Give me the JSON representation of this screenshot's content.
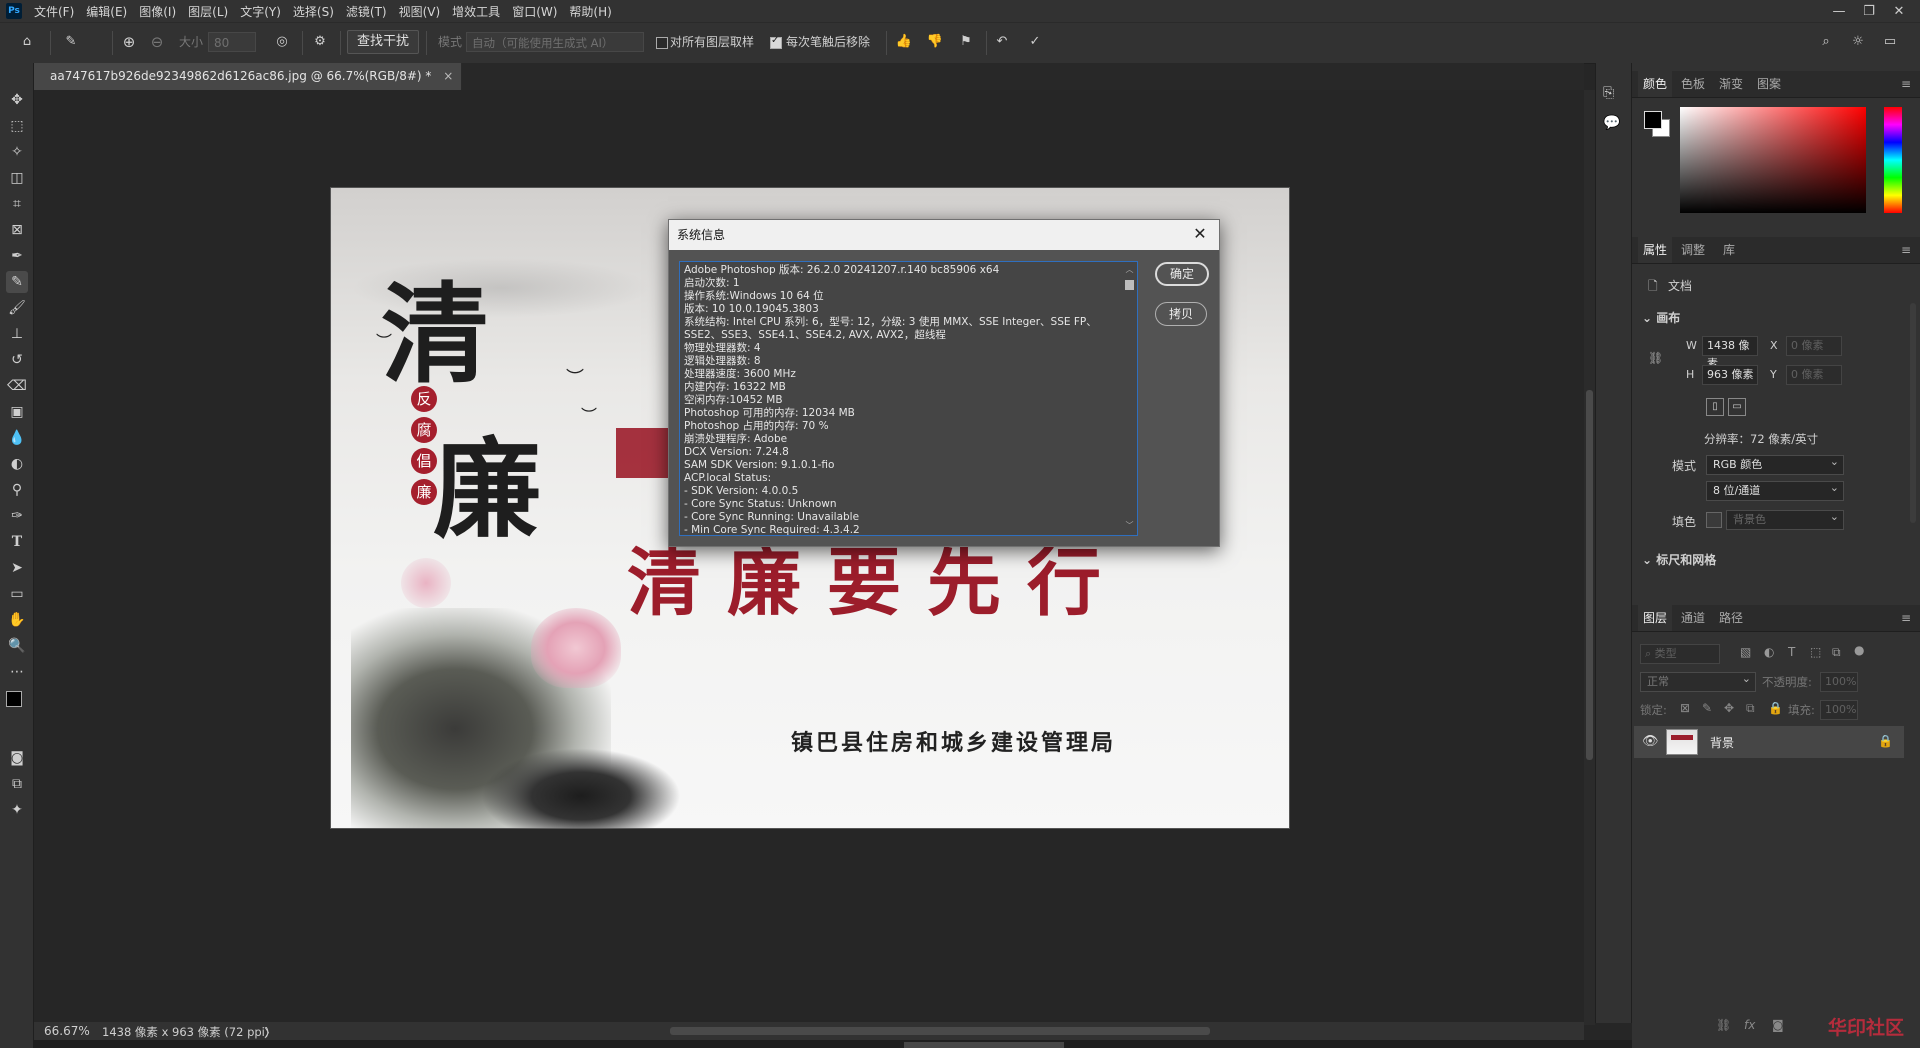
{
  "menubar": {
    "logo": "Ps",
    "items": [
      "文件(F)",
      "编辑(E)",
      "图像(I)",
      "图层(L)",
      "文字(Y)",
      "选择(S)",
      "滤镜(T)",
      "视图(V)",
      "增效工具",
      "窗口(W)",
      "帮助(H)"
    ],
    "window_buttons": [
      "—",
      "❐",
      "✕"
    ]
  },
  "options": {
    "size_label": "大小",
    "size_value": "80",
    "find_interference": "查找干扰",
    "mode_label": "模式",
    "mode_value": "自动（可能使用生成式 AI）",
    "sample_all_layers": "对所有图层取样",
    "remove_after_stroke": "每次笔触后移除"
  },
  "document": {
    "tab_title": "aa747617b926de92349862d6126ac86.jpg @ 66.7%(RGB/8#) *",
    "tab_close": "×"
  },
  "artwork": {
    "big_char_1": "清",
    "big_char_2": "廉",
    "seals": [
      "反",
      "腐",
      "倡",
      "廉"
    ],
    "slogan": "清廉要先行",
    "organization": "镇巴县住房和城乡建设管理局"
  },
  "dialog": {
    "title": "系统信息",
    "close": "✕",
    "ok": "确定",
    "copy": "拷贝",
    "lines": [
      "Adobe Photoshop 版本: 26.2.0 20241207.r.140 bc85906  x64",
      "启动次数: 1",
      "操作系统:Windows 10 64 位",
      "版本: 10 10.0.19045.3803",
      "系统结构: Intel CPU 系列: 6，型号: 12，分级: 3 使用 MMX、SSE Integer、SSE FP、",
      "SSE2、SSE3、SSE4.1、SSE4.2, AVX, AVX2，超线程",
      "物理处理器数: 4",
      "逻辑处理器数: 8",
      "处理器速度: 3600 MHz",
      "内建内存: 16322 MB",
      "空闲内存:10452 MB",
      "Photoshop 可用的内存: 12034 MB",
      "Photoshop 占用的内存: 70 %",
      "崩溃处理程序: Adobe",
      "DCX Version: 7.24.8",
      "SAM SDK Version: 9.1.0.1-fio",
      "ACP.local Status:",
      " - SDK Version: 4.0.0.5",
      " - Core Sync Status: Unknown",
      " - Core Sync Running: Unavailable",
      " - Min Core Sync Required: 4.3.4.2"
    ]
  },
  "statusbar": {
    "zoom": "66.67%",
    "doc_info": "1438 像素 x 963 像素 (72 ppi)",
    "arrow": "〉"
  },
  "panels": {
    "color_tabs": [
      "颜色",
      "色板",
      "渐变",
      "图案"
    ],
    "props_tabs": [
      "属性",
      "调整",
      "库"
    ],
    "doc_label": "文档",
    "canvas_section": "画布",
    "w_label": "W",
    "w_value": "1438 像素",
    "h_label": "H",
    "h_value": "963 像素",
    "x_label": "X",
    "x_placeholder": "0 像素",
    "y_label": "Y",
    "y_placeholder": "0 像素",
    "resolution": "分辨率：72 像素/英寸",
    "mode_label": "模式",
    "mode_value": "RGB 颜色",
    "depth_value": "8 位/通道",
    "fill_label": "填色",
    "fill_value": "背景色",
    "rulers_section": "标尺和网格",
    "layers_tabs": [
      "图层",
      "通道",
      "路径"
    ],
    "search_placeholder": "类型",
    "blend_mode": "正常",
    "opacity_label": "不透明度:",
    "opacity_value": "100%",
    "lock_label": "锁定:",
    "fill2_label": "填充:",
    "fill2_value": "100%",
    "layer_name": "背景"
  },
  "watermark": "华印社区"
}
